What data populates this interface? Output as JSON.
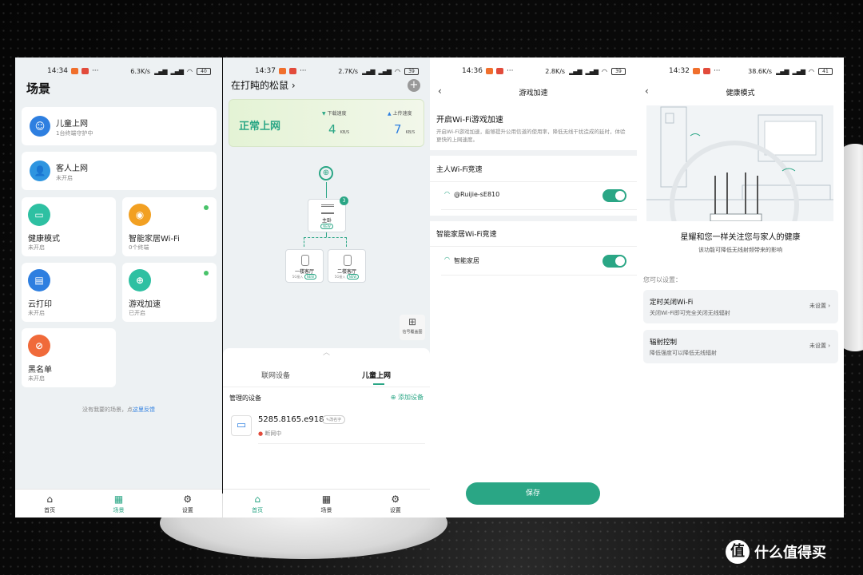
{
  "colors": {
    "brand_green": "#2aa685",
    "bg_panel": "#edf1f3",
    "status_bg": "#e5f4d9"
  },
  "phone1": {
    "status": {
      "time": "14:34",
      "speed": "6.3K/s",
      "battery": "40"
    },
    "page_title": "场景",
    "cards": [
      {
        "title": "儿童上网",
        "sub": "1台终端守护中",
        "icon": "child-face-icon",
        "color": "#2e7fe0"
      },
      {
        "title": "客人上网",
        "sub": "未开启",
        "icon": "guest-user-icon",
        "color": "#2e95e0"
      },
      {
        "title": "健康模式",
        "sub": "未开启",
        "icon": "tv-health-icon",
        "color": "#2ec0a2"
      },
      {
        "title": "智能家居Wi-Fi",
        "sub": "0个终端",
        "icon": "smart-speaker-icon",
        "color": "#f2a022"
      },
      {
        "title": "云打印",
        "sub": "未开启",
        "icon": "printer-icon",
        "color": "#2e7fe0"
      },
      {
        "title": "游戏加速",
        "sub": "已开启",
        "icon": "gamepad-icon",
        "color": "#2ec0a2"
      },
      {
        "title": "黑名单",
        "sub": "未开启",
        "icon": "blacklist-user-icon",
        "color": "#f06a3a"
      }
    ],
    "feedback_prefix": "没有我要的场景，点",
    "feedback_link": "这里反馈",
    "tabs": [
      "首页",
      "场景",
      "设置"
    ]
  },
  "phone2": {
    "status": {
      "time": "14:37",
      "speed": "2.7K/s",
      "battery": "39"
    },
    "network_name": "在打盹的松鼠",
    "net_status": "正常上网",
    "download_label": "下载速度",
    "download_value": "4",
    "download_unit": "KB/S",
    "upload_label": "上传速度",
    "upload_value": "7",
    "upload_unit": "KB/S",
    "main_node": {
      "label": "主卧",
      "tag": "NEW",
      "badge": "3"
    },
    "sub_nodes": [
      {
        "label": "一楼客厅",
        "tag1": "5G接入",
        "tag2": "NEW"
      },
      {
        "label": "二楼客厅",
        "tag1": "5G接入",
        "tag2": "NEW"
      }
    ],
    "coverage_label": "信号覆盖图",
    "sheet_tabs": [
      "联网设备",
      "儿童上网"
    ],
    "managed_label": "管理的设备",
    "add_device": "添加设备",
    "device_name": "5285.8165.e918",
    "rename": "改名字",
    "device_status": "断网中",
    "tabs": [
      "首页",
      "场景",
      "设置"
    ]
  },
  "phone3": {
    "status": {
      "time": "14:36",
      "speed": "2.8K/s",
      "battery": "39"
    },
    "title": "游戏加速",
    "section_title": "开启Wi-Fi游戏加速",
    "section_desc": "开启Wi-Fi游戏加速，能够提升公用信道的使用率，降低无线干扰造成的延时，体验更快的上网速度。",
    "main_wifi_label": "主人Wi-Fi竞速",
    "main_wifi_name": "@Ruijie-sE810",
    "main_wifi_on": true,
    "smart_wifi_label": "智能家居Wi-Fi竞速",
    "smart_wifi_name": "智能家居",
    "smart_wifi_on": true,
    "save": "保存"
  },
  "phone4": {
    "status": {
      "time": "14:32",
      "speed": "38.6K/s",
      "battery": "41"
    },
    "title": "健康模式",
    "headline": "星耀和您一样关注您与家人的健康",
    "subline": "该功能可降低无线射频带来的影响",
    "can_set": "您可以设置：",
    "options": [
      {
        "title": "定时关闭Wi-Fi",
        "desc": "关闭Wi-Fi即可完全关闭无线辐射",
        "state": "未设置"
      },
      {
        "title": "辐射控制",
        "desc": "降低强度可以降低无线辐射",
        "state": "未设置"
      }
    ]
  },
  "watermark": "什么值得买"
}
